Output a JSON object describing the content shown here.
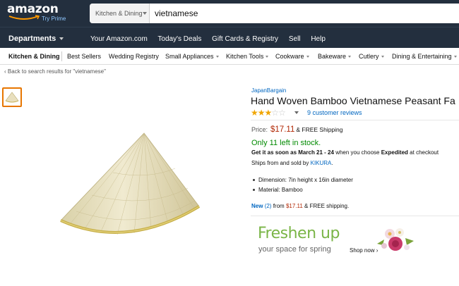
{
  "header": {
    "logo_text": "amazon",
    "logo_prime": "Try Prime",
    "search_category": "Kitchen & Dining",
    "search_value": "vietnamese"
  },
  "navbar": {
    "departments": "Departments",
    "links": [
      "Your Amazon.com",
      "Today's Deals",
      "Gift Cards & Registry",
      "Sell",
      "Help"
    ]
  },
  "subnav": {
    "items": [
      "Kitchen & Dining",
      "Best Sellers",
      "Wedding Registry",
      "Small Appliances",
      "Kitchen Tools",
      "Cookware",
      "Bakeware",
      "Cutlery",
      "Dining & Entertaining"
    ]
  },
  "back_link": "‹ Back to search results for \"vietnamese\"",
  "product": {
    "brand": "JapanBargain",
    "title": "Hand Woven Bamboo Vietnamese Peasant Fa",
    "rating": 3,
    "rating_max": 5,
    "reviews": "9 customer reviews",
    "price_label": "Price:",
    "price": "$17.11",
    "shipping": "& FREE Shipping",
    "stock": "Only 11 left in stock.",
    "delivery_prefix": "Get it as soon as",
    "delivery_date": "March 21 - 24",
    "delivery_mid": "when you choose",
    "delivery_option": "Expedited",
    "delivery_suffix": "at checkout",
    "ships_prefix": "Ships from and sold by",
    "seller": "KIKURA",
    "ships_suffix": ".",
    "bullets": [
      "Dimension: 7in height x 16in diameter",
      "Material: Bamboo"
    ],
    "new_label": "New",
    "new_count": "(2)",
    "new_from": "from",
    "new_price": "$17.11",
    "new_shipping": "& FREE shipping."
  },
  "ad": {
    "headline": "Freshen up",
    "subline": "your space for spring",
    "cta": "Shop now ›"
  }
}
